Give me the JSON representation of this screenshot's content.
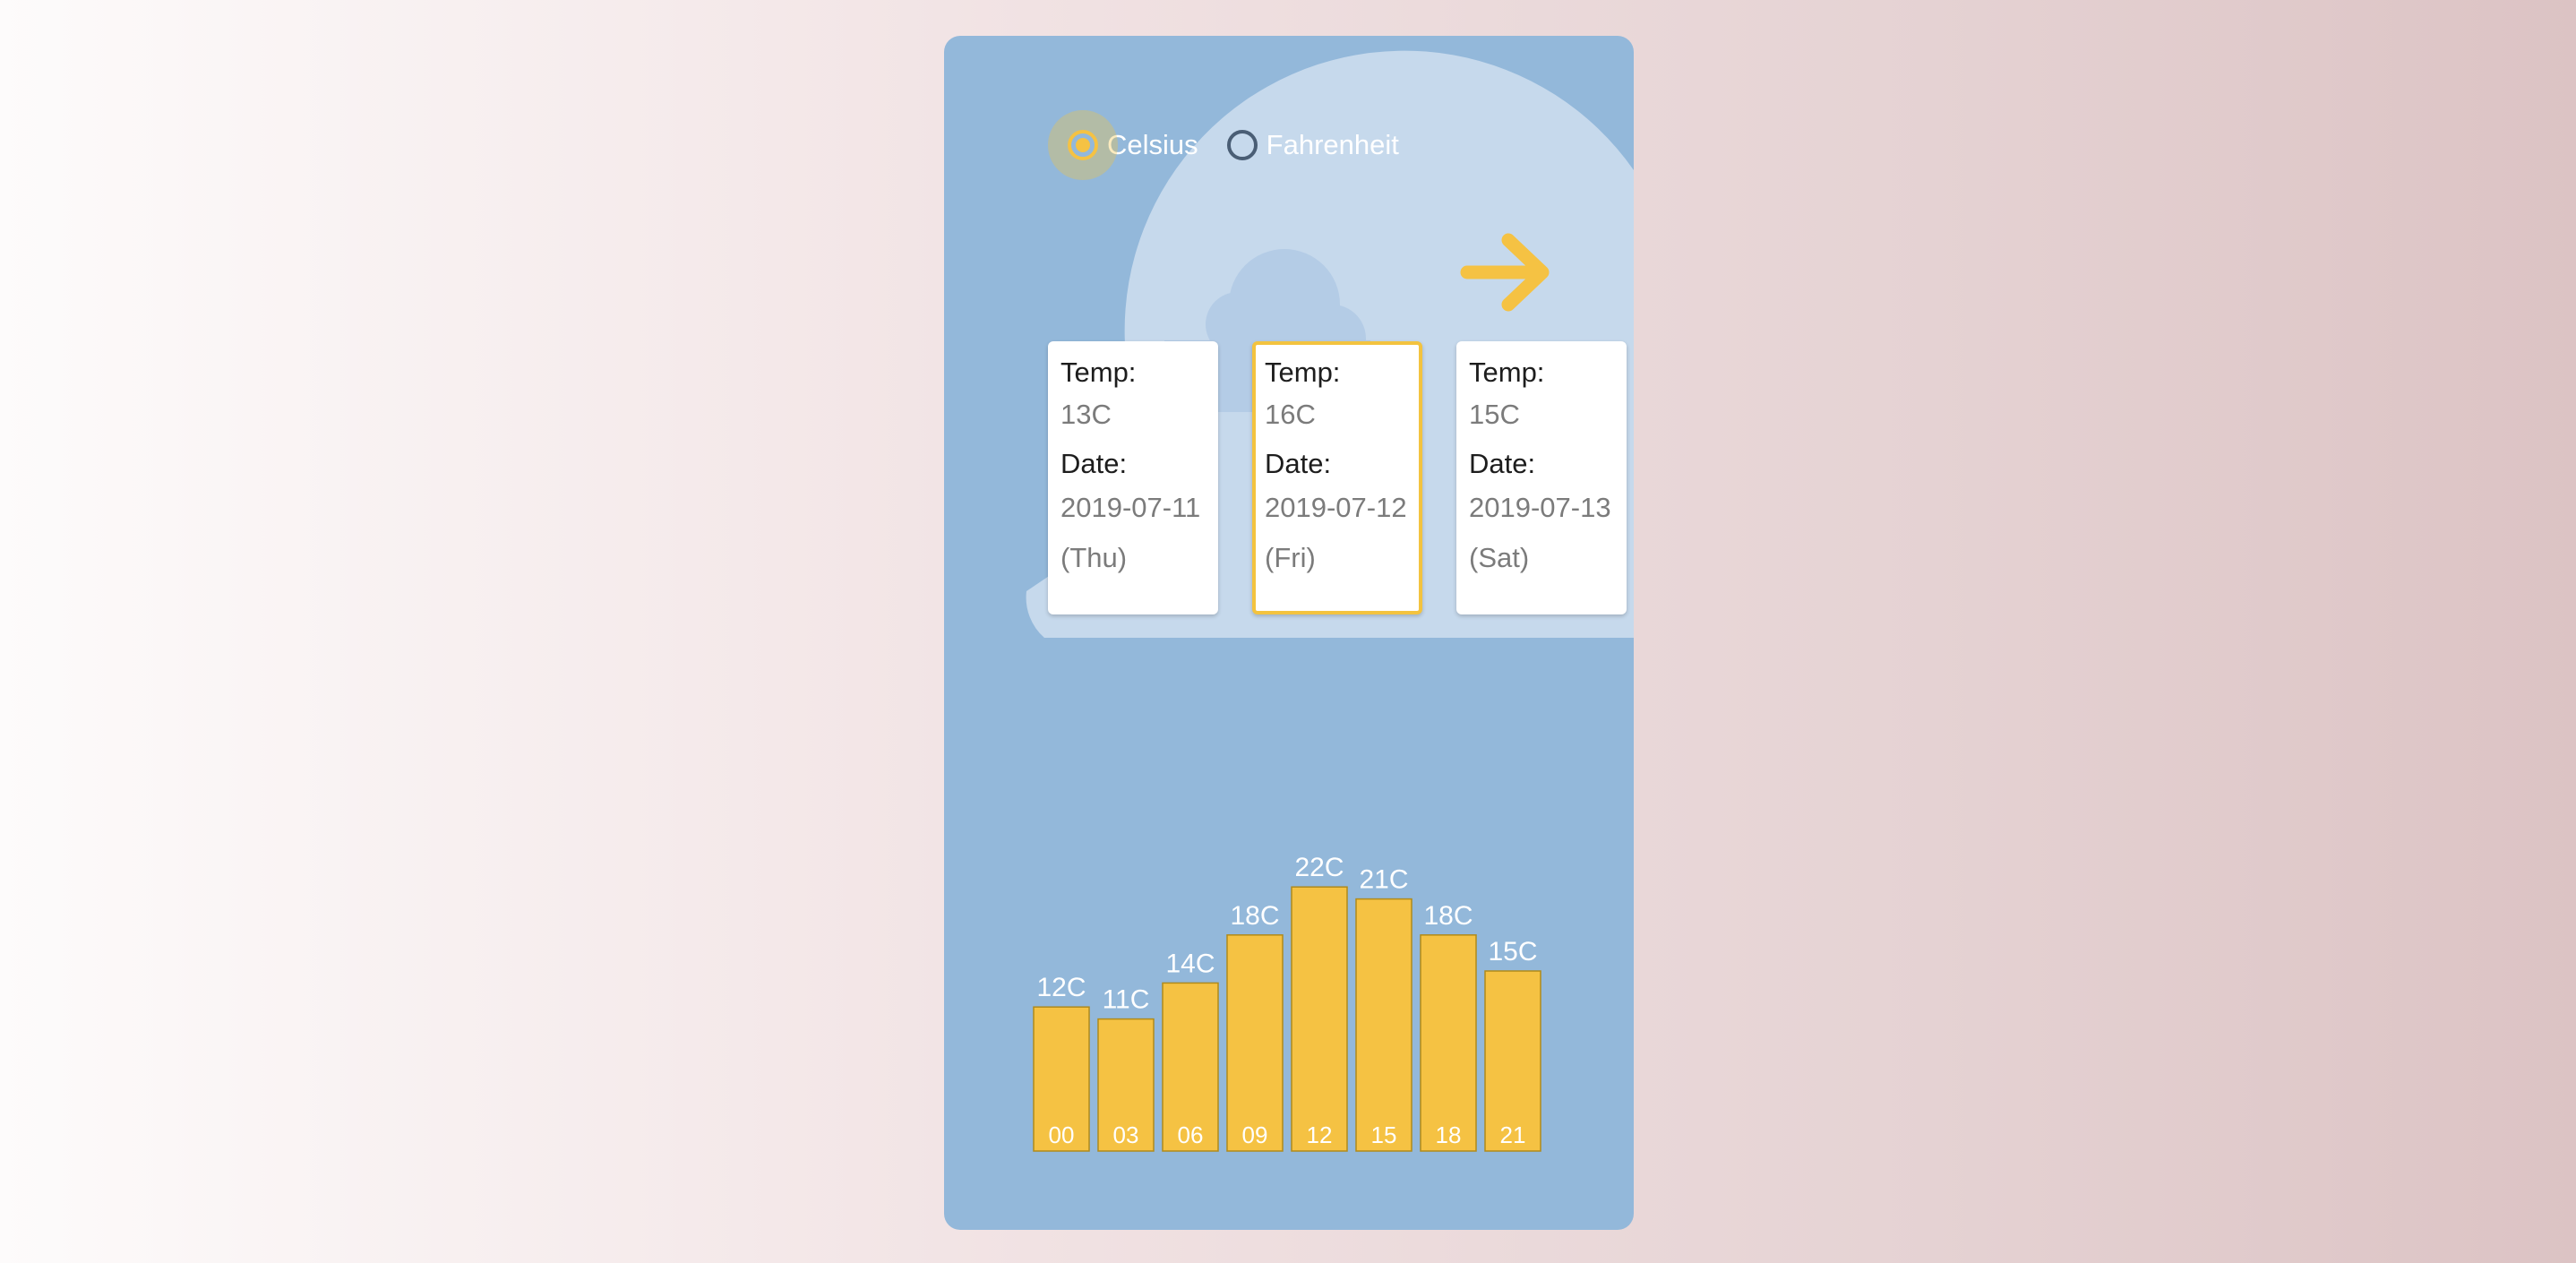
{
  "units": {
    "options": [
      {
        "label": "Celsius",
        "selected": true
      },
      {
        "label": "Fahrenheit",
        "selected": false
      }
    ]
  },
  "navigation": {
    "next_icon": "arrow-right-icon"
  },
  "forecast_cards": [
    {
      "temp_label": "Temp:",
      "temp": "13C",
      "date_label": "Date:",
      "date": "2019-07-11",
      "day": "(Thu)",
      "selected": false
    },
    {
      "temp_label": "Temp:",
      "temp": "16C",
      "date_label": "Date:",
      "date": "2019-07-12",
      "day": "(Fri)",
      "selected": true
    },
    {
      "temp_label": "Temp:",
      "temp": "15C",
      "date_label": "Date:",
      "date": "2019-07-13",
      "day": "(Sat)",
      "selected": false
    }
  ],
  "colors": {
    "panel": "#93b8da",
    "accent": "#f5c243",
    "cloud": "#c6d9ec"
  },
  "chart_data": {
    "type": "bar",
    "categories": [
      "00",
      "03",
      "06",
      "09",
      "12",
      "15",
      "18",
      "21"
    ],
    "values": [
      12,
      11,
      14,
      18,
      22,
      21,
      18,
      15
    ],
    "value_labels": [
      "12C",
      "11C",
      "14C",
      "18C",
      "22C",
      "21C",
      "18C",
      "15C"
    ],
    "unit": "C",
    "title": "",
    "xlabel": "",
    "ylabel": "",
    "grid": false
  }
}
